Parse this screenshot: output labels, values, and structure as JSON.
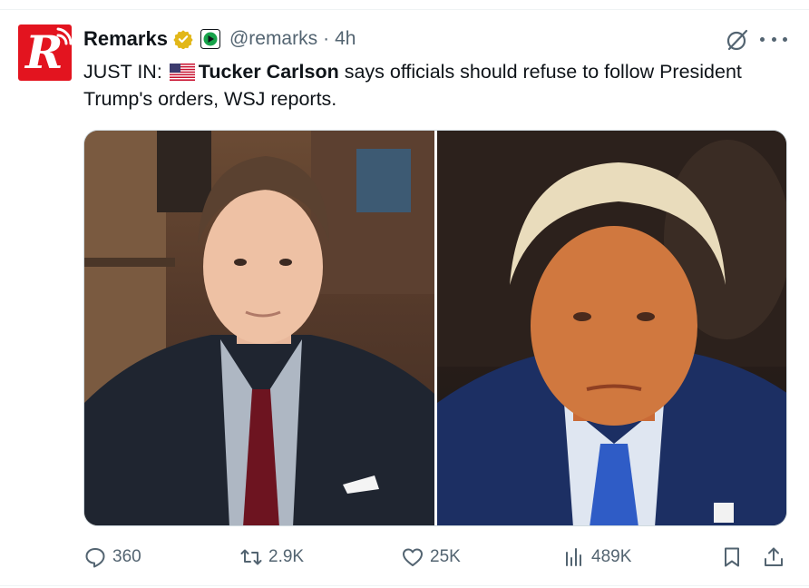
{
  "tweet": {
    "author": {
      "display_name": "Remarks",
      "handle": "@remarks",
      "avatar_letter": "R",
      "avatar_color": "#e3141f",
      "verified_badge": "gold-check-icon"
    },
    "separator": "·",
    "time": "4h",
    "text": {
      "prefix": "JUST IN: ",
      "flag": "us-flag-icon",
      "bold": "Tucker Carlson",
      "rest": " says officials should refuse to follow President Trump's orders, WSJ reports."
    },
    "media": [
      {
        "icon": "photo-tucker-carlson"
      },
      {
        "icon": "photo-donald-trump"
      }
    ],
    "stats": {
      "replies": "360",
      "reposts": "2.9K",
      "likes": "25K",
      "views": "489K"
    }
  },
  "colors": {
    "text_primary": "#0f1419",
    "text_secondary": "#536471",
    "border": "#cfd9de",
    "verified_gold": "#e2b719"
  }
}
